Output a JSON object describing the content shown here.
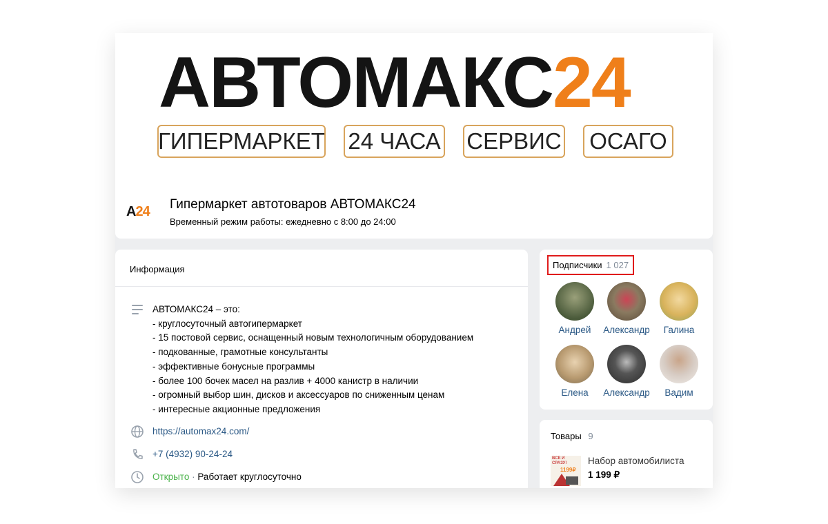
{
  "cover": {
    "brand_black": "АВТОМАКС",
    "brand_orange": "24",
    "tags": [
      "ГИПЕРМАРКЕТ",
      "24 ЧАСА",
      "СЕРВИС",
      "ОСАГО"
    ]
  },
  "group": {
    "logo_letter": "A",
    "logo_number": "24",
    "title": "Гипермаркет автотоваров АВТОМАКС24",
    "status": "Временный режим работы: ежедневно с 8:00 до 24:00"
  },
  "info": {
    "heading": "Информация",
    "description": [
      "АВТОМАКС24 – это:",
      "- круглосуточный автогипермаркет",
      "- 15 постовой сервис, оснащенный новым технологичным оборудованием",
      "- подкованные, грамотные консультанты",
      "- эффективные бонусные программы",
      "- более 100 бочек масел на разлив + 4000 канистр в наличии",
      "- огромный выбор шин, дисков и аксессуаров по сниженным ценам",
      "- интересные акционные предложения"
    ],
    "website": "https://automax24.com/",
    "phone": "+7 (4932) 90-24-24",
    "open_label": "Открыто",
    "separator": "·",
    "hours": "Работает круглосуточно"
  },
  "subscribers": {
    "label": "Подписчики",
    "count": "1 027",
    "members": [
      {
        "name": "Андрей",
        "color": "#4a5a3a"
      },
      {
        "name": "Александр",
        "color": "#8a7a60"
      },
      {
        "name": "Галина",
        "color": "#d9b35c"
      },
      {
        "name": "Елена",
        "color": "#b89a70"
      },
      {
        "name": "Александр",
        "color": "#2b2b2b"
      },
      {
        "name": "Вадим",
        "color": "#d7ccc4"
      }
    ]
  },
  "goods": {
    "label": "Товары",
    "count": "9",
    "item_name": "Набор автомобилиста",
    "item_price": "1 199 ₽",
    "thumb_text": "ВСЁ И СРАЗУ!",
    "thumb_price": "1199₽"
  },
  "colors": {
    "brand_orange": "#ef7f1a",
    "link": "#2a5885",
    "open": "#4bb34b",
    "highlight": "#e01b1b"
  }
}
